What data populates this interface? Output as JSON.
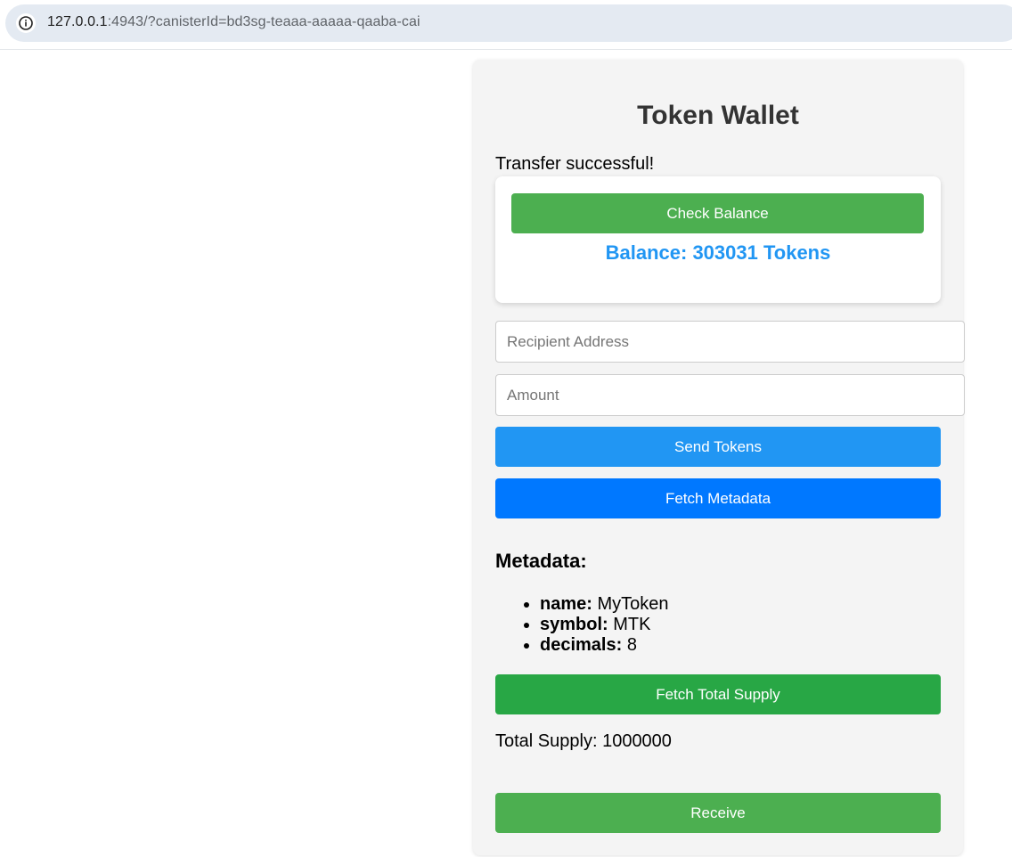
{
  "browser": {
    "url_host": "127.0.0.1",
    "url_rest": ":4943/?canisterId=bd3sg-teaaa-aaaaa-qaaba-cai",
    "info_icon": "info-icon"
  },
  "wallet": {
    "title": "Token Wallet",
    "status": "Transfer successful!",
    "check_balance_label": "Check Balance",
    "balance_text": "Balance: 303031 Tokens",
    "recipient_placeholder": "Recipient Address",
    "amount_placeholder": "Amount",
    "send_label": "Send Tokens",
    "fetch_metadata_label": "Fetch Metadata",
    "metadata_heading": "Metadata:",
    "metadata": [
      {
        "key": "name:",
        "value": "MyToken"
      },
      {
        "key": "symbol:",
        "value": "MTK"
      },
      {
        "key": "decimals:",
        "value": "8"
      }
    ],
    "fetch_supply_label": "Fetch Total Supply",
    "total_supply_text": "Total Supply: 1000000",
    "receive_label": "Receive"
  },
  "colors": {
    "green": "#4caf50",
    "blue": "#2196f3",
    "bright_blue": "#0078ff",
    "dark_green": "#28a745",
    "balance_text": "#2196f3",
    "card_bg": "#f4f4f4"
  }
}
